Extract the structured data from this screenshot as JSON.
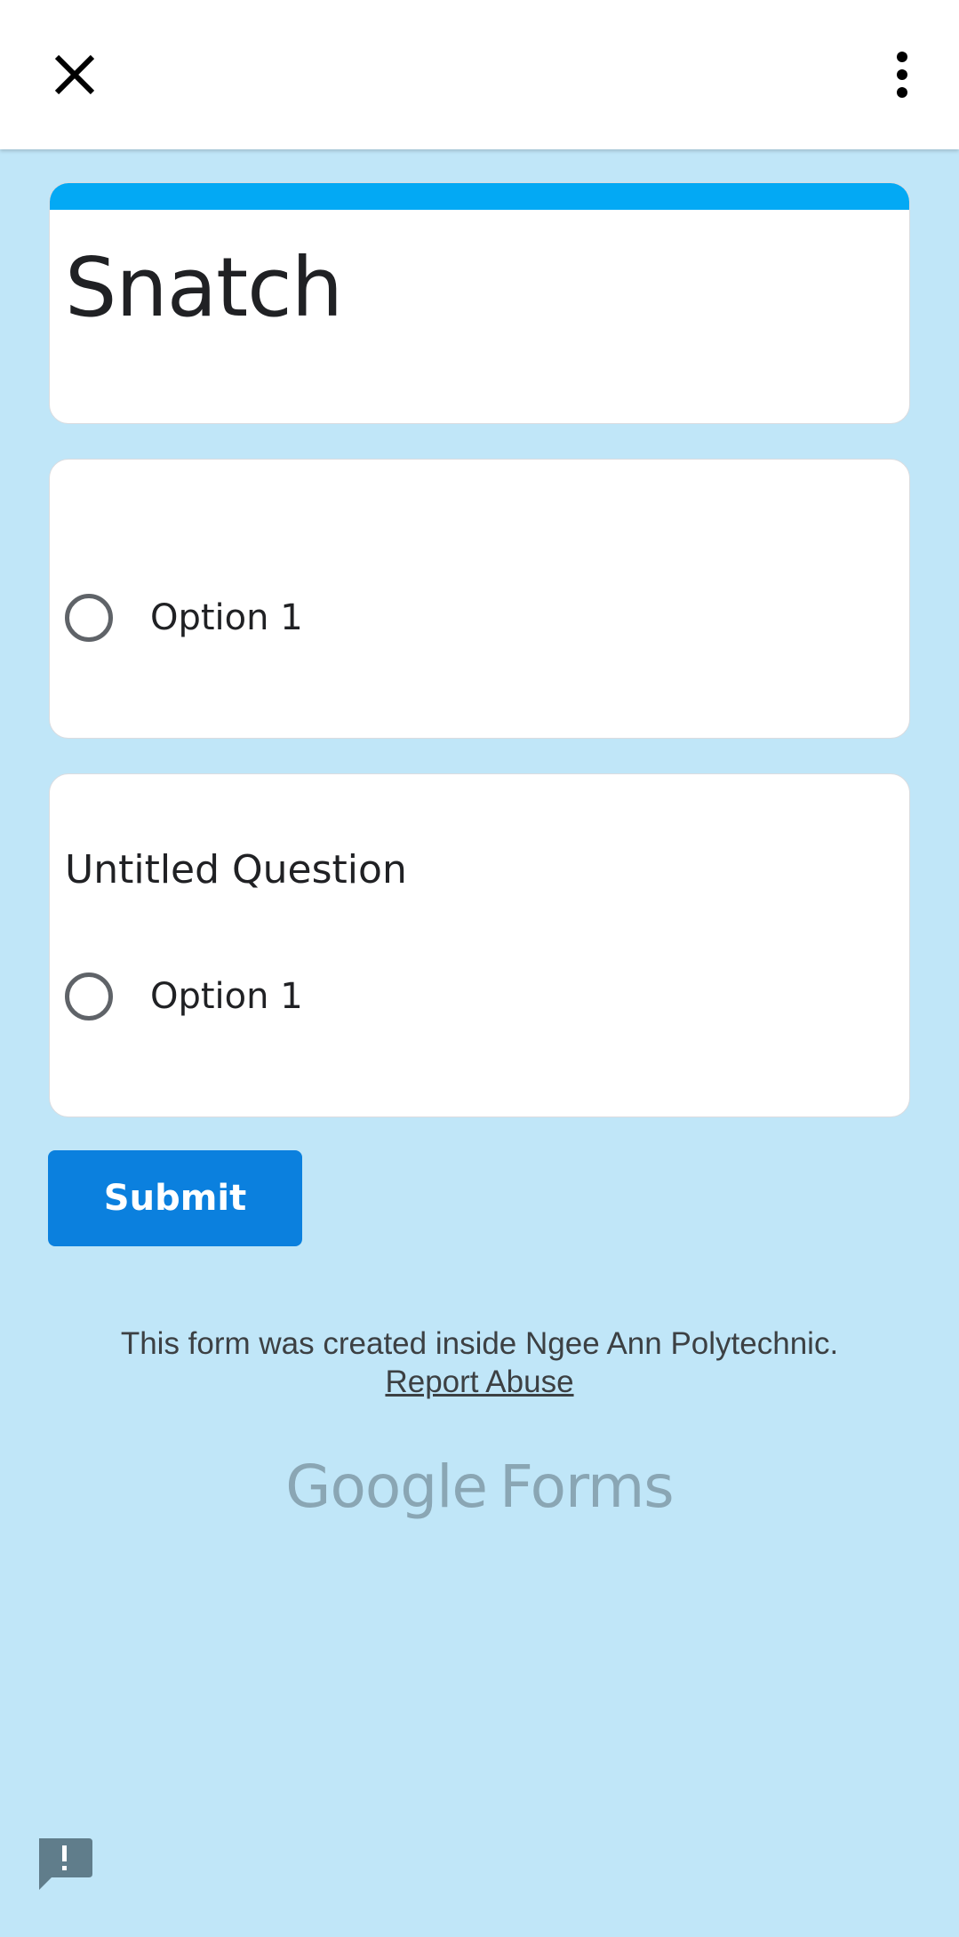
{
  "topbar": {
    "close_icon": "close-icon",
    "more_icon": "more-vert-icon"
  },
  "form": {
    "title": "Snatch",
    "accent_color": "#03a9f4"
  },
  "questions": [
    {
      "title": "",
      "options": [
        {
          "label": "Option 1"
        }
      ]
    },
    {
      "title": "Untitled Question",
      "options": [
        {
          "label": "Option 1"
        }
      ]
    }
  ],
  "submit": {
    "label": "Submit",
    "color": "#0b80de"
  },
  "footer": {
    "notice": "This form was created inside Ngee Ann Polytechnic.",
    "report_link": "Report Abuse",
    "brand_part1": "Google",
    "brand_part2": "Forms"
  },
  "feedback": {
    "icon": "feedback-icon"
  }
}
